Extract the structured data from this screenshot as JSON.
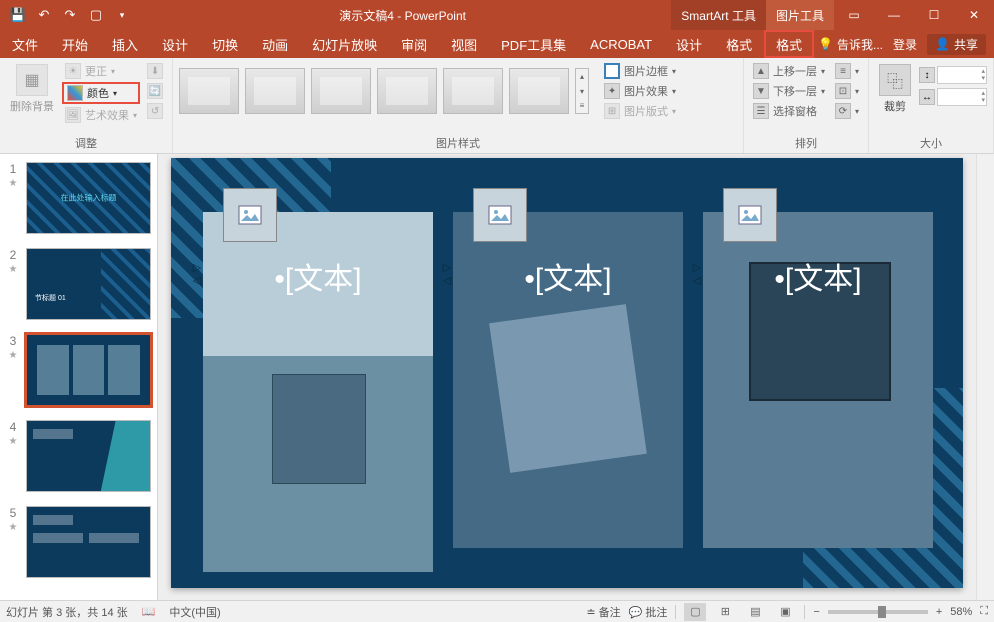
{
  "title": "演示文稿4 - PowerPoint",
  "context_tabs": {
    "smartart": "SmartArt 工具",
    "picture": "图片工具"
  },
  "tabs": {
    "file": "文件",
    "home": "开始",
    "insert": "插入",
    "design": "设计",
    "transitions": "切换",
    "animations": "动画",
    "slideshow": "幻灯片放映",
    "review": "审阅",
    "view": "视图",
    "pdf": "PDF工具集",
    "acrobat": "ACROBAT",
    "design2": "设计",
    "format1": "格式",
    "format2": "格式"
  },
  "tellme": "告诉我...",
  "signin": "登录",
  "share": "共享",
  "ribbon": {
    "adjust": {
      "label": "调整",
      "remove_bg": "删除背景",
      "corrections": "更正",
      "color": "颜色",
      "artistic": "艺术效果"
    },
    "styles": {
      "label": "图片样式",
      "border": "图片边框",
      "effects": "图片效果",
      "layout": "图片版式"
    },
    "arrange": {
      "label": "排列",
      "forward": "上移一层",
      "backward": "下移一层",
      "selection": "选择窗格"
    },
    "size": {
      "label": "大小",
      "crop": "裁剪"
    }
  },
  "slides": {
    "s1_title": "在此处输入标题",
    "s2_section": "节标题 01",
    "nums": [
      "1",
      "2",
      "3",
      "4",
      "5"
    ]
  },
  "canvas": {
    "text_placeholder": "•[文本]",
    "vmarker": "▷◁"
  },
  "status": {
    "slide_info": "幻灯片 第 3 张，共 14 张",
    "lang": "中文(中国)",
    "notes": "备注",
    "comments": "批注",
    "zoom": "58%"
  }
}
